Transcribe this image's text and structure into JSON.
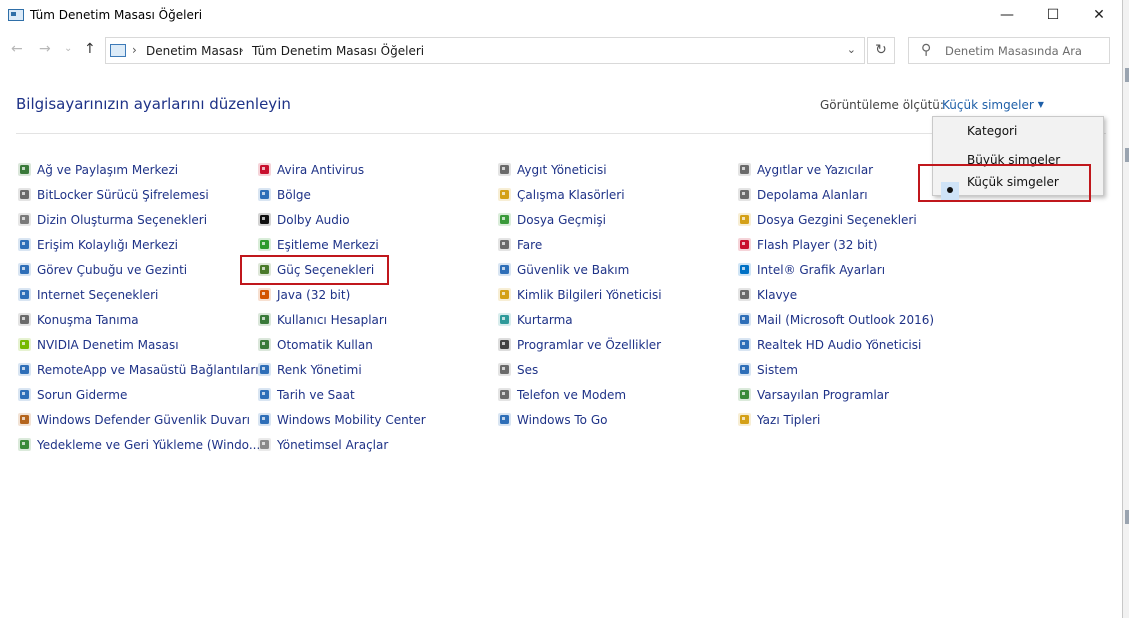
{
  "window": {
    "title": "Tüm Denetim Masası Öğeleri",
    "minimize": "—",
    "maximize": "☐",
    "close": "✕"
  },
  "nav": {
    "back": "←",
    "forward": "→",
    "recent": "⌄",
    "up": "↑"
  },
  "address": {
    "crumbs": [
      "Denetim Masası",
      "Tüm Denetim Masası Öğeleri"
    ],
    "separator": "›",
    "dropdown": "⌄"
  },
  "refresh": "↻",
  "search": {
    "icon": "⚲",
    "placeholder": "Denetim Masasında Ara"
  },
  "header": {
    "title": "Bilgisayarınızın ayarlarını düzenleyin",
    "view_label": "Görüntüleme ölçütü:",
    "view_value": "Küçük simgeler",
    "caret": "▼"
  },
  "view_menu": {
    "options": [
      "Kategori",
      "Büyük simgeler",
      "Küçük simgeler"
    ],
    "selected": "Küçük simgeler"
  },
  "columns": [
    [
      {
        "label": "Ağ ve Paylaşım Merkezi",
        "icon": "network-icon",
        "color": "#3a7a3a"
      },
      {
        "label": "BitLocker Sürücü Şifrelemesi",
        "icon": "bitlocker-icon",
        "color": "#6b6b6b"
      },
      {
        "label": "Dizin Oluşturma Seçenekleri",
        "icon": "indexing-icon",
        "color": "#7a7a7a"
      },
      {
        "label": "Erişim Kolaylığı Merkezi",
        "icon": "accessibility-icon",
        "color": "#2f6fb8"
      },
      {
        "label": "Görev Çubuğu ve Gezinti",
        "icon": "taskbar-icon",
        "color": "#2f6fb8"
      },
      {
        "label": "Internet Seçenekleri",
        "icon": "internet-options-icon",
        "color": "#2f6fb8"
      },
      {
        "label": "Konuşma Tanıma",
        "icon": "microphone-icon",
        "color": "#6b6b6b"
      },
      {
        "label": "NVIDIA Denetim Masası",
        "icon": "nvidia-icon",
        "color": "#76b900"
      },
      {
        "label": "RemoteApp ve Masaüstü Bağlantıları",
        "icon": "remoteapp-icon",
        "color": "#2f6fb8"
      },
      {
        "label": "Sorun Giderme",
        "icon": "troubleshooting-icon",
        "color": "#2f6fb8"
      },
      {
        "label": "Windows Defender Güvenlik Duvarı",
        "icon": "firewall-icon",
        "color": "#b5651d"
      },
      {
        "label": "Yedekleme ve Geri Yükleme (Windo...",
        "icon": "backup-icon",
        "color": "#3a8a3a"
      }
    ],
    [
      {
        "label": "Avira Antivirus",
        "icon": "avira-icon",
        "color": "#c8102e"
      },
      {
        "label": "Bölge",
        "icon": "region-icon",
        "color": "#2f6fb8"
      },
      {
        "label": "Dolby Audio",
        "icon": "dolby-icon",
        "color": "#111111"
      },
      {
        "label": "Eşitleme Merkezi",
        "icon": "sync-center-icon",
        "color": "#2f9a2f"
      },
      {
        "label": "Güç Seçenekleri",
        "icon": "power-options-icon",
        "color": "#4a7a2a"
      },
      {
        "label": "Java (32 bit)",
        "icon": "java-icon",
        "color": "#d35400"
      },
      {
        "label": "Kullanıcı Hesapları",
        "icon": "user-accounts-icon",
        "color": "#3a7a3a"
      },
      {
        "label": "Otomatik Kullan",
        "icon": "autoplay-icon",
        "color": "#3a7a3a"
      },
      {
        "label": "Renk Yönetimi",
        "icon": "color-management-icon",
        "color": "#2f6fb8"
      },
      {
        "label": "Tarih ve Saat",
        "icon": "date-time-icon",
        "color": "#2f6fb8"
      },
      {
        "label": "Windows Mobility Center",
        "icon": "mobility-center-icon",
        "color": "#2f6fb8"
      },
      {
        "label": "Yönetimsel Araçlar",
        "icon": "admin-tools-icon",
        "color": "#8a8a8a"
      }
    ],
    [
      {
        "label": "Aygıt Yöneticisi",
        "icon": "device-manager-icon",
        "color": "#6b6b6b"
      },
      {
        "label": "Çalışma Klasörleri",
        "icon": "work-folders-icon",
        "color": "#d4a017"
      },
      {
        "label": "Dosya Geçmişi",
        "icon": "file-history-icon",
        "color": "#3a9a3a"
      },
      {
        "label": "Fare",
        "icon": "mouse-icon",
        "color": "#6b6b6b"
      },
      {
        "label": "Güvenlik ve Bakım",
        "icon": "security-flag-icon",
        "color": "#2f6fb8"
      },
      {
        "label": "Kimlik Bilgileri Yöneticisi",
        "icon": "credential-manager-icon",
        "color": "#d4a017"
      },
      {
        "label": "Kurtarma",
        "icon": "recovery-icon",
        "color": "#2f9a9a"
      },
      {
        "label": "Programlar ve Özellikler",
        "icon": "programs-icon",
        "color": "#444444"
      },
      {
        "label": "Ses",
        "icon": "sound-icon",
        "color": "#6b6b6b"
      },
      {
        "label": "Telefon ve Modem",
        "icon": "phone-modem-icon",
        "color": "#6b6b6b"
      },
      {
        "label": "Windows To Go",
        "icon": "windows-to-go-icon",
        "color": "#2f6fb8"
      }
    ],
    [
      {
        "label": "Aygıtlar ve Yazıcılar",
        "icon": "devices-printers-icon",
        "color": "#6b6b6b"
      },
      {
        "label": "Depolama Alanları",
        "icon": "storage-spaces-icon",
        "color": "#6b6b6b"
      },
      {
        "label": "Dosya Gezgini Seçenekleri",
        "icon": "folder-options-icon",
        "color": "#d4a017"
      },
      {
        "label": "Flash Player (32 bit)",
        "icon": "flash-icon",
        "color": "#c8102e"
      },
      {
        "label": "Intel® Grafik Ayarları",
        "icon": "intel-graphics-icon",
        "color": "#0071c5"
      },
      {
        "label": "Klavye",
        "icon": "keyboard-icon",
        "color": "#6b6b6b"
      },
      {
        "label": "Mail (Microsoft Outlook 2016)",
        "icon": "mail-icon",
        "color": "#2f6fb8"
      },
      {
        "label": "Realtek HD Audio Yöneticisi",
        "icon": "realtek-icon",
        "color": "#2f6fb8"
      },
      {
        "label": "Sistem",
        "icon": "system-icon",
        "color": "#2f6fb8"
      },
      {
        "label": "Varsayılan Programlar",
        "icon": "default-programs-icon",
        "color": "#3a8a3a"
      },
      {
        "label": "Yazı Tipleri",
        "icon": "fonts-icon",
        "color": "#d4a017"
      }
    ]
  ]
}
